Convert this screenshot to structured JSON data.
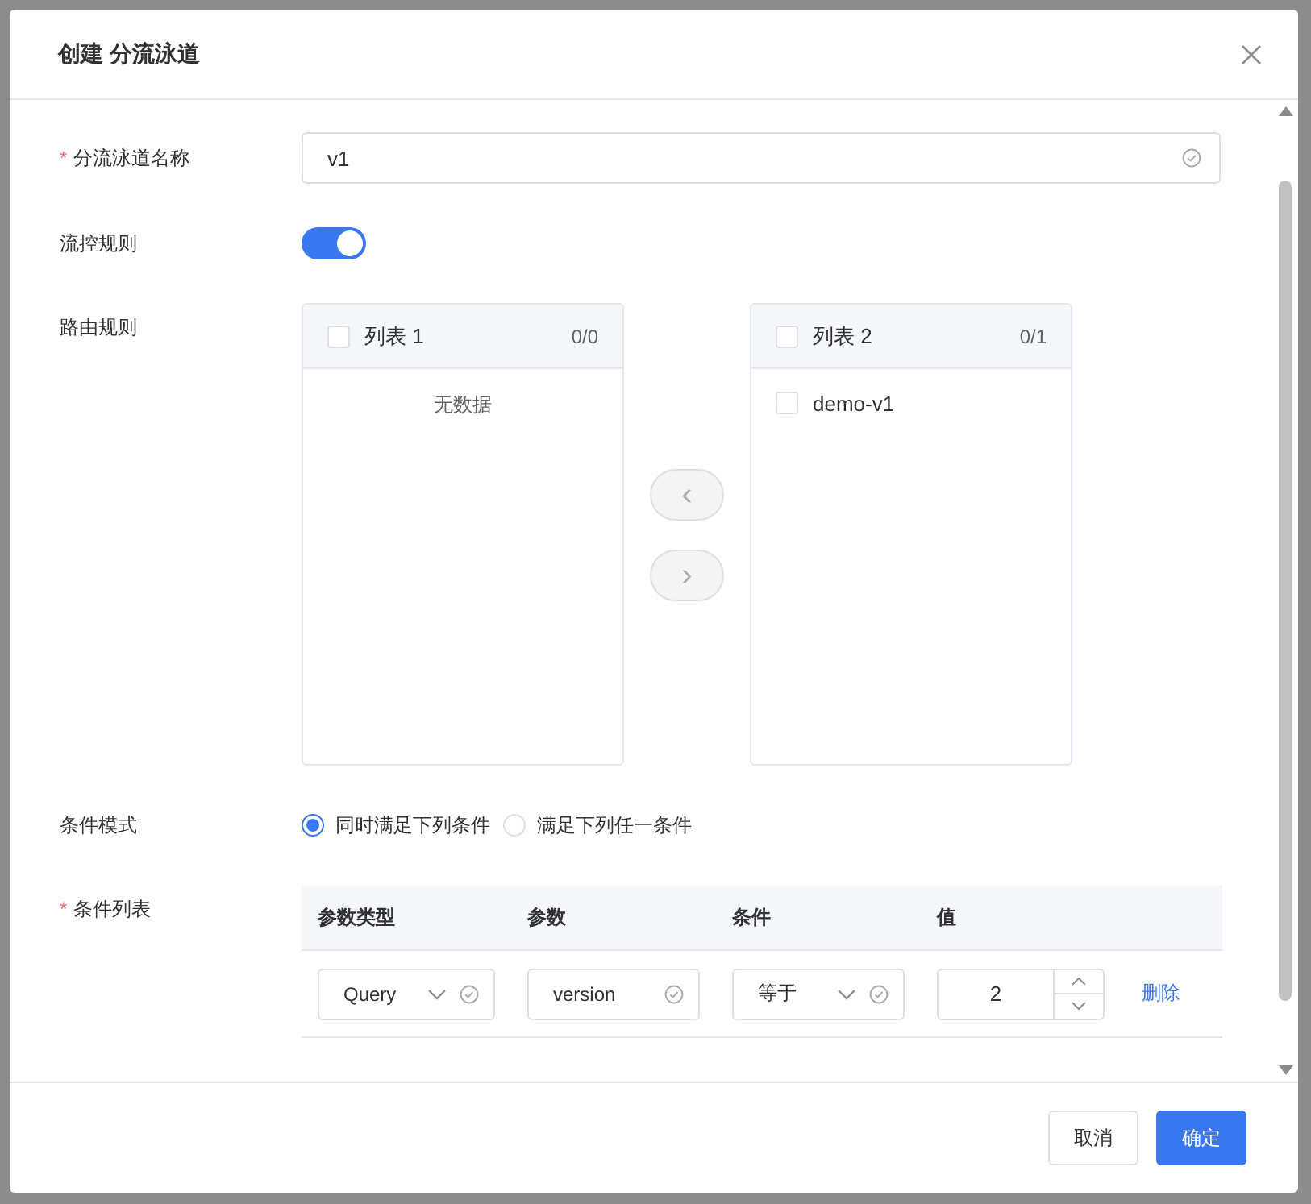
{
  "dialog": {
    "title": "创建 分流泳道"
  },
  "name_field": {
    "label": "分流泳道名称",
    "required_mark": "*",
    "value": "v1"
  },
  "flow_control": {
    "label": "流控规则",
    "on": true
  },
  "routing": {
    "label": "路由规则",
    "lists": [
      {
        "title": "列表 1",
        "count": "0/0",
        "checked": false,
        "empty_text": "无数据"
      },
      {
        "title": "列表 2",
        "count": "0/1",
        "checked": false,
        "items": [
          {
            "label": "demo-v1",
            "checked": false
          }
        ]
      }
    ],
    "move_buttons": [
      "‹",
      "›"
    ]
  },
  "condition_mode": {
    "label": "条件模式",
    "options": [
      {
        "label": "同时满足下列条件",
        "selected": true
      },
      {
        "label": "满足下列任一条件",
        "selected": false
      }
    ]
  },
  "conditions": {
    "label": "条件列表",
    "required_mark": "*",
    "columns": [
      "参数类型",
      "参数",
      "条件",
      "值"
    ],
    "rows": [
      {
        "param_type": "Query",
        "param": "version",
        "operator": "等于",
        "value": "2",
        "action": "删除"
      }
    ]
  },
  "footer": {
    "buttons": [
      {
        "label": "取消",
        "kind": "default"
      },
      {
        "label": "确定",
        "kind": "primary"
      }
    ]
  }
}
